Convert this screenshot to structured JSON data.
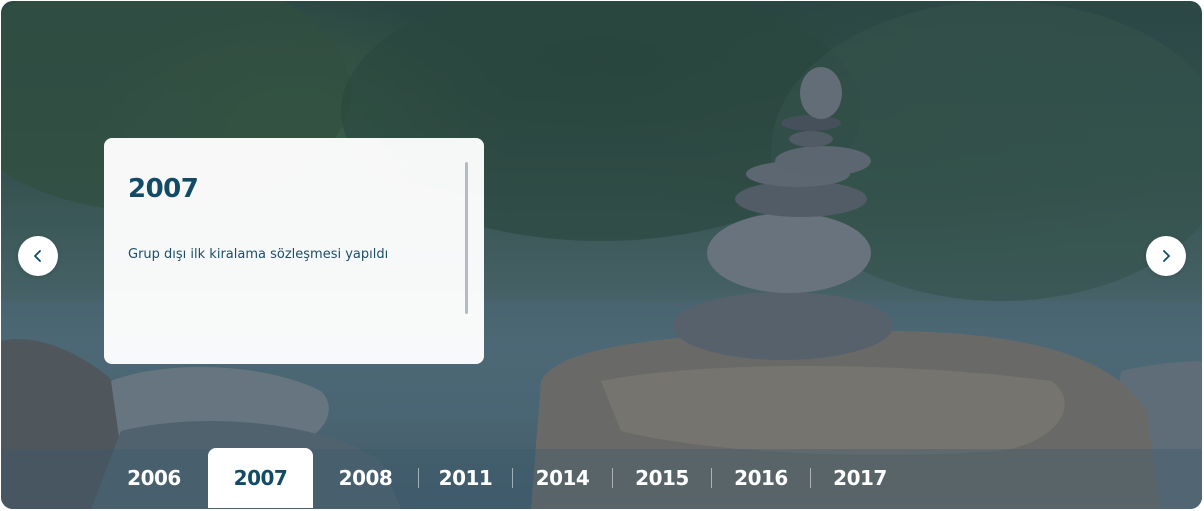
{
  "slider": {
    "prev_icon": "chevron-left-icon",
    "next_icon": "chevron-right-icon"
  },
  "card": {
    "year": "2007",
    "text": "Grup dışı ilk kiralama sözleşmesi yapıldı"
  },
  "timeline": {
    "years": [
      "2006",
      "2007",
      "2008",
      "2011",
      "2014",
      "2015",
      "2016",
      "2017"
    ],
    "active": "2007"
  },
  "colors": {
    "accent": "#124b66",
    "card_bg": "#ffffff",
    "nav_bg": "#ffffff"
  }
}
